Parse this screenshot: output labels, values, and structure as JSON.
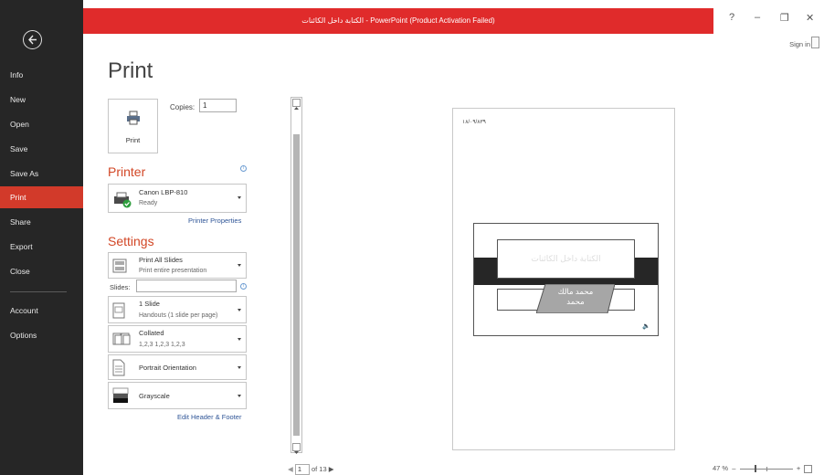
{
  "window": {
    "title": "الكتابة داخل الكائنات - PowerPoint (Product Activation Failed)",
    "help": "?",
    "minimize": "–",
    "restore": "❐",
    "close": "✕",
    "sign_in": "Sign in",
    "accent": "#e02b2b"
  },
  "nav": {
    "items": [
      {
        "label": "Info"
      },
      {
        "label": "New"
      },
      {
        "label": "Open"
      },
      {
        "label": "Save"
      },
      {
        "label": "Save As"
      },
      {
        "label": "Print",
        "active": true
      },
      {
        "label": "Share"
      },
      {
        "label": "Export"
      },
      {
        "label": "Close"
      },
      {
        "label": "Account"
      },
      {
        "label": "Options"
      }
    ]
  },
  "print": {
    "heading": "Print",
    "print_button": "Print",
    "copies_label": "Copies:",
    "copies_value": "1",
    "printer_section": "Printer",
    "printer_name": "Canon LBP-810",
    "printer_status": "Ready",
    "printer_properties": "Printer Properties",
    "settings_section": "Settings",
    "slides_range_main": "Print All Slides",
    "slides_range_sub": "Print entire presentation",
    "slides_label": "Slides:",
    "slides_value": "",
    "layout_main": "1 Slide",
    "layout_sub": "Handouts (1 slide per page)",
    "collate_main": "Collated",
    "collate_sub": "1,2,3   1,2,3   1,2,3",
    "orientation": "Portrait Orientation",
    "color": "Grayscale",
    "edit_header_footer": "Edit Header & Footer"
  },
  "preview": {
    "date": "١٨/٠٩/٨٣٩",
    "slide_title": "الكتابة داخل الكائنات",
    "slide_subtitle_line1": "محمد مالك",
    "slide_subtitle_line2": "محمد",
    "current_page": "1",
    "page_total": "of 13"
  },
  "zoom": {
    "percent": "47 %"
  }
}
